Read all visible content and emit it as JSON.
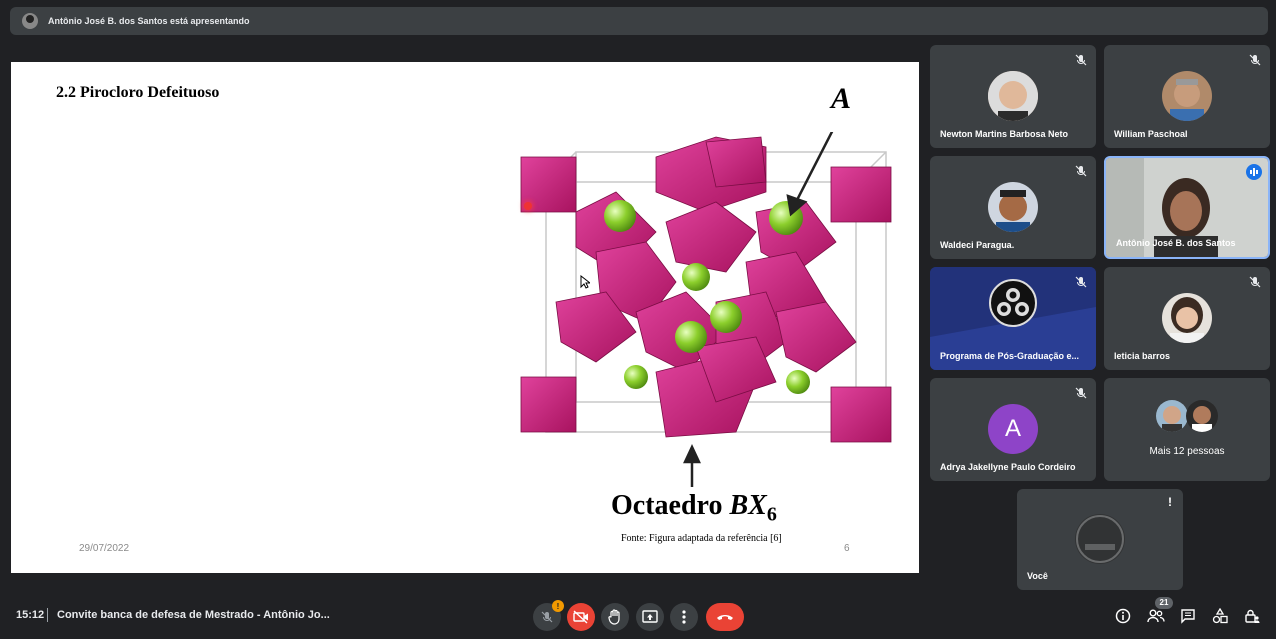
{
  "banner": {
    "presenting_text": "Antônio José B. dos Santos está apresentando"
  },
  "slide": {
    "title": "2.2 Pirocloro Defeituoso",
    "label_a": "A",
    "label_octaedro": "Octaedro ",
    "label_bx": "BX",
    "label_sub": "6",
    "caption": "Fonte: Figura adaptada da referência  [6]",
    "date": "29/07/2022",
    "page_number": "6"
  },
  "participants": [
    {
      "name": "Newton Martins Barbosa Neto",
      "muted": true
    },
    {
      "name": "William Paschoal",
      "muted": true
    },
    {
      "name": "Waldeci Paragua.",
      "muted": true
    },
    {
      "name": "Antônio José B. dos Santos",
      "speaking": true
    },
    {
      "name": "Programa de Pós-Graduação e...",
      "muted": true
    },
    {
      "name": "leticia barros",
      "muted": true
    },
    {
      "name": "Adrya Jakellyne Paulo Cordeiro",
      "initial": "A",
      "muted": true,
      "avatar_color": "#8e44c8"
    },
    {
      "label": "Mais 12 pessoas"
    },
    {
      "name": "Você"
    }
  ],
  "controls": {
    "time": "15:12",
    "meeting_title": "Convite banca de defesa de Mestrado - Antônio Jo...",
    "mic_badge": "!",
    "people_count": "21"
  },
  "colors": {
    "accent_red": "#ea4335",
    "speaking_blue": "#8ab4f8",
    "tile_bg": "#3c4043",
    "page_bg": "#202124"
  }
}
